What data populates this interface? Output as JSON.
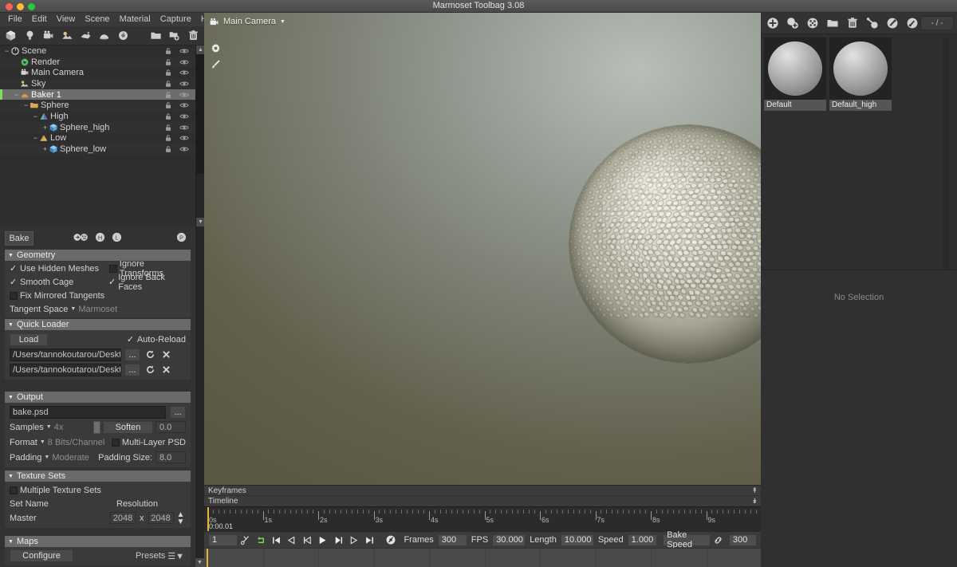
{
  "window": {
    "title": "Marmoset Toolbag 3.08"
  },
  "menubar": {
    "items": [
      "File",
      "Edit",
      "View",
      "Scene",
      "Material",
      "Capture",
      "Help"
    ]
  },
  "left_toolbar": {
    "icons": [
      "mesh-icon",
      "light-icon",
      "camera-icon",
      "sky-icon",
      "fog-icon",
      "baker-icon",
      "render-icon",
      "folder-icon",
      "duplicate-icon",
      "trash-icon"
    ]
  },
  "scene_tree": {
    "items": [
      {
        "label": "Scene",
        "depth": 0,
        "icon": "scene-icon",
        "expander": "minus",
        "selected": false
      },
      {
        "label": "Render",
        "depth": 1,
        "icon": "render-icon",
        "expander": "none",
        "selected": false
      },
      {
        "label": "Main Camera",
        "depth": 1,
        "icon": "camera-icon",
        "expander": "none",
        "selected": false
      },
      {
        "label": "Sky",
        "depth": 1,
        "icon": "sky-icon",
        "expander": "none",
        "selected": false
      },
      {
        "label": "Baker 1",
        "depth": 1,
        "icon": "baker-icon",
        "expander": "minus",
        "selected": true
      },
      {
        "label": "Sphere",
        "depth": 2,
        "icon": "folder-icon",
        "expander": "minus",
        "selected": false
      },
      {
        "label": "High",
        "depth": 3,
        "icon": "high-mesh-icon",
        "expander": "minus",
        "selected": false
      },
      {
        "label": "Sphere_high",
        "depth": 4,
        "icon": "mesh-cube-icon",
        "expander": "plus",
        "selected": false
      },
      {
        "label": "Low",
        "depth": 3,
        "icon": "low-mesh-icon",
        "expander": "minus",
        "selected": false
      },
      {
        "label": "Sphere_low",
        "depth": 4,
        "icon": "mesh-cube-icon",
        "expander": "plus",
        "selected": false
      }
    ],
    "row_icons": [
      "lock-icon",
      "eye-icon"
    ]
  },
  "bake_panel": {
    "tab_label": "Bake",
    "header_icons": [
      "bake-all-icon",
      "high-icon",
      "low-icon",
      "preview-icon"
    ],
    "geometry": {
      "title": "Geometry",
      "use_hidden_meshes": {
        "label": "Use Hidden Meshes",
        "checked": true
      },
      "ignore_transforms": {
        "label": "Ignore Transforms",
        "checked": false
      },
      "smooth_cage": {
        "label": "Smooth Cage",
        "checked": true
      },
      "ignore_back_faces": {
        "label": "Ignore Back Faces",
        "checked": true
      },
      "fix_mirrored_tangents": {
        "label": "Fix Mirrored Tangents",
        "checked": false
      },
      "tangent_space_label": "Tangent Space",
      "tangent_space_value": "Marmoset"
    },
    "quick_loader": {
      "title": "Quick Loader",
      "load_label": "Load",
      "auto_reload": {
        "label": "Auto-Reload",
        "checked": true
      },
      "paths": [
        "/Users/tannokoutarou/Deskto",
        "/Users/tannokoutarou/Deskto"
      ],
      "browse_label": "...",
      "reload_icon": "refresh-icon",
      "clear_icon": "close-icon"
    },
    "output": {
      "title": "Output",
      "filename": "bake.psd",
      "browse_label": "...",
      "samples_label": "Samples",
      "samples_value": "4x",
      "soften_label": "Soften",
      "soften_value": "0.0",
      "format_label": "Format",
      "format_value": "8 Bits/Channel",
      "multi_layer_psd": {
        "label": "Multi-Layer PSD",
        "checked": false
      },
      "padding_label": "Padding",
      "padding_value": "Moderate",
      "padding_size_label": "Padding Size:",
      "padding_size_value": "8.0"
    },
    "texture_sets": {
      "title": "Texture Sets",
      "multiple_texture_sets": {
        "label": "Multiple Texture Sets",
        "checked": false
      },
      "col_set_name": "Set Name",
      "col_resolution": "Resolution",
      "row_name": "Master",
      "res_width": "2048",
      "res_separator": "x",
      "res_height": "2048"
    },
    "maps": {
      "title": "Maps",
      "configure_label": "Configure",
      "presets_label": "Presets"
    }
  },
  "viewport": {
    "camera_label": "Main Camera",
    "camera_icon": "camera-icon",
    "dropdown_icon": "chevron-down-icon",
    "side_icons": [
      "gear-icon",
      "brush-icon"
    ]
  },
  "timeline": {
    "keyframes_label": "Keyframes",
    "timeline_label": "Timeline",
    "ruler_labels": [
      "0s",
      "1s",
      "2s",
      "3s",
      "4s",
      "5s",
      "6s",
      "7s",
      "8s",
      "9s"
    ],
    "playhead_time": "0:00.01",
    "current_frame": "1",
    "transport_icons": [
      "scissors-icon",
      "loop-icon",
      "skip-start-icon",
      "step-back-icon",
      "prev-frame-icon",
      "play-icon",
      "next-frame-icon",
      "step-forward-icon",
      "skip-end-icon",
      "record-icon"
    ],
    "frames_label": "Frames",
    "frames_value": "300",
    "fps_label": "FPS",
    "fps_value": "30.000",
    "length_label": "Length",
    "length_value": "10.000",
    "speed_label": "Speed",
    "speed_value": "1.000",
    "bake_speed_label": "Bake Speed",
    "link_icon": "link-icon",
    "bake_speed_value": "300"
  },
  "right_panel": {
    "toolbar_icons": [
      "add-icon",
      "duplicate-icon",
      "random-icon",
      "folder-icon",
      "trash-icon",
      "assign-icon",
      "paint-icon",
      "picker-icon"
    ],
    "page_field": "- / -",
    "materials": [
      {
        "name": "Default"
      },
      {
        "name": "Default_high"
      }
    ],
    "no_selection_text": "No Selection"
  },
  "colors": {
    "accent_green": "#7ddf5a",
    "playhead": "#e8b53c",
    "panel_bg": "#323232",
    "tree_bg": "#2e2e2e",
    "selection": "#6d6d6d"
  }
}
